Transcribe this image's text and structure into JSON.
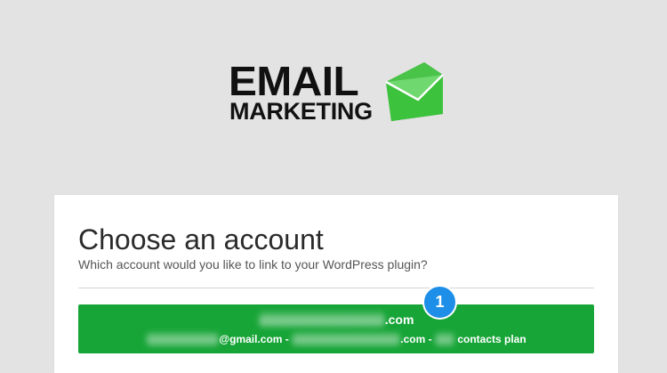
{
  "logo": {
    "line1": "EMAIL",
    "line2": "MARKETING",
    "icon": "envelope-icon",
    "brand_color": "#3cc23c",
    "text_color": "#111111"
  },
  "card": {
    "title": "Choose an account",
    "subtitle": "Which account would you like to link to your WordPress plugin?"
  },
  "account": {
    "line1_domain": ".com",
    "line2_email_suffix": "@gmail.com",
    "line2_sep": " - ",
    "line2_domain": ".com",
    "line2_plan": " contacts plan",
    "button_color": "#18a538"
  },
  "annotation": {
    "badge_number": "1",
    "badge_color": "#1e8fe8"
  },
  "colors": {
    "page_background": "#e3e3e3",
    "card_background": "#ffffff"
  }
}
